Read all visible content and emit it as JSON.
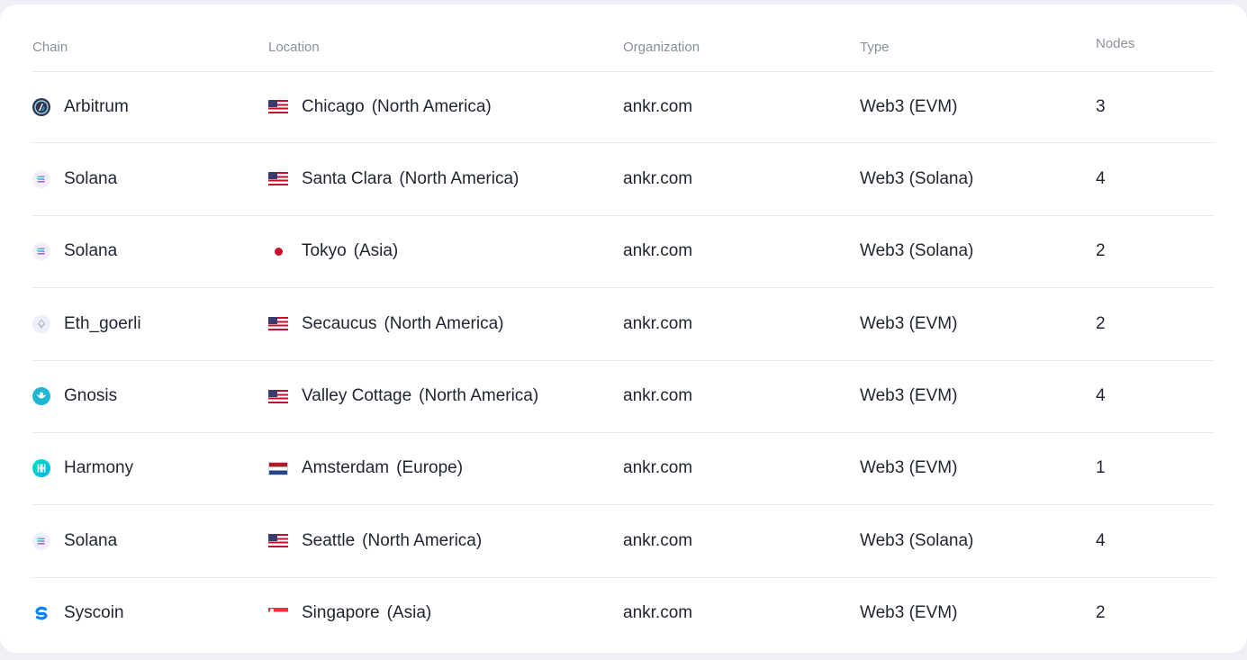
{
  "columns": {
    "chain": "Chain",
    "location": "Location",
    "organization": "Organization",
    "type": "Type",
    "nodes": "Nodes"
  },
  "rows": [
    {
      "chain": "Arbitrum",
      "chain_icon": "arbitrum-icon",
      "flag": "us-flag-icon",
      "city": "Chicago",
      "region": "(North America)",
      "org": "ankr.com",
      "type": "Web3 (EVM)",
      "nodes": "3"
    },
    {
      "chain": "Solana",
      "chain_icon": "solana-icon",
      "flag": "us-flag-icon",
      "city": "Santa Clara",
      "region": "(North America)",
      "org": "ankr.com",
      "type": "Web3 (Solana)",
      "nodes": "4"
    },
    {
      "chain": "Solana",
      "chain_icon": "solana-icon",
      "flag": "jp-flag-icon",
      "city": "Tokyo",
      "region": "(Asia)",
      "org": "ankr.com",
      "type": "Web3 (Solana)",
      "nodes": "2"
    },
    {
      "chain": "Eth_goerli",
      "chain_icon": "ethereum-icon",
      "flag": "us-flag-icon",
      "city": "Secaucus",
      "region": "(North America)",
      "org": "ankr.com",
      "type": "Web3 (EVM)",
      "nodes": "2"
    },
    {
      "chain": "Gnosis",
      "chain_icon": "gnosis-icon",
      "flag": "us-flag-icon",
      "city": "Valley Cottage",
      "region": "(North America)",
      "org": "ankr.com",
      "type": "Web3 (EVM)",
      "nodes": "4"
    },
    {
      "chain": "Harmony",
      "chain_icon": "harmony-icon",
      "flag": "nl-flag-icon",
      "city": "Amsterdam",
      "region": "(Europe)",
      "org": "ankr.com",
      "type": "Web3 (EVM)",
      "nodes": "1"
    },
    {
      "chain": "Solana",
      "chain_icon": "solana-icon",
      "flag": "us-flag-icon",
      "city": "Seattle",
      "region": "(North America)",
      "org": "ankr.com",
      "type": "Web3 (Solana)",
      "nodes": "4"
    },
    {
      "chain": "Syscoin",
      "chain_icon": "syscoin-icon",
      "flag": "sg-flag-icon",
      "city": "Singapore",
      "region": "(Asia)",
      "org": "ankr.com",
      "type": "Web3 (EVM)",
      "nodes": "2"
    }
  ],
  "colors": {
    "page_bg": "#eef0f5",
    "card_bg": "#ffffff",
    "header_text": "#8a909c",
    "body_text": "#1f2430",
    "divider": "#e7e9ef"
  }
}
